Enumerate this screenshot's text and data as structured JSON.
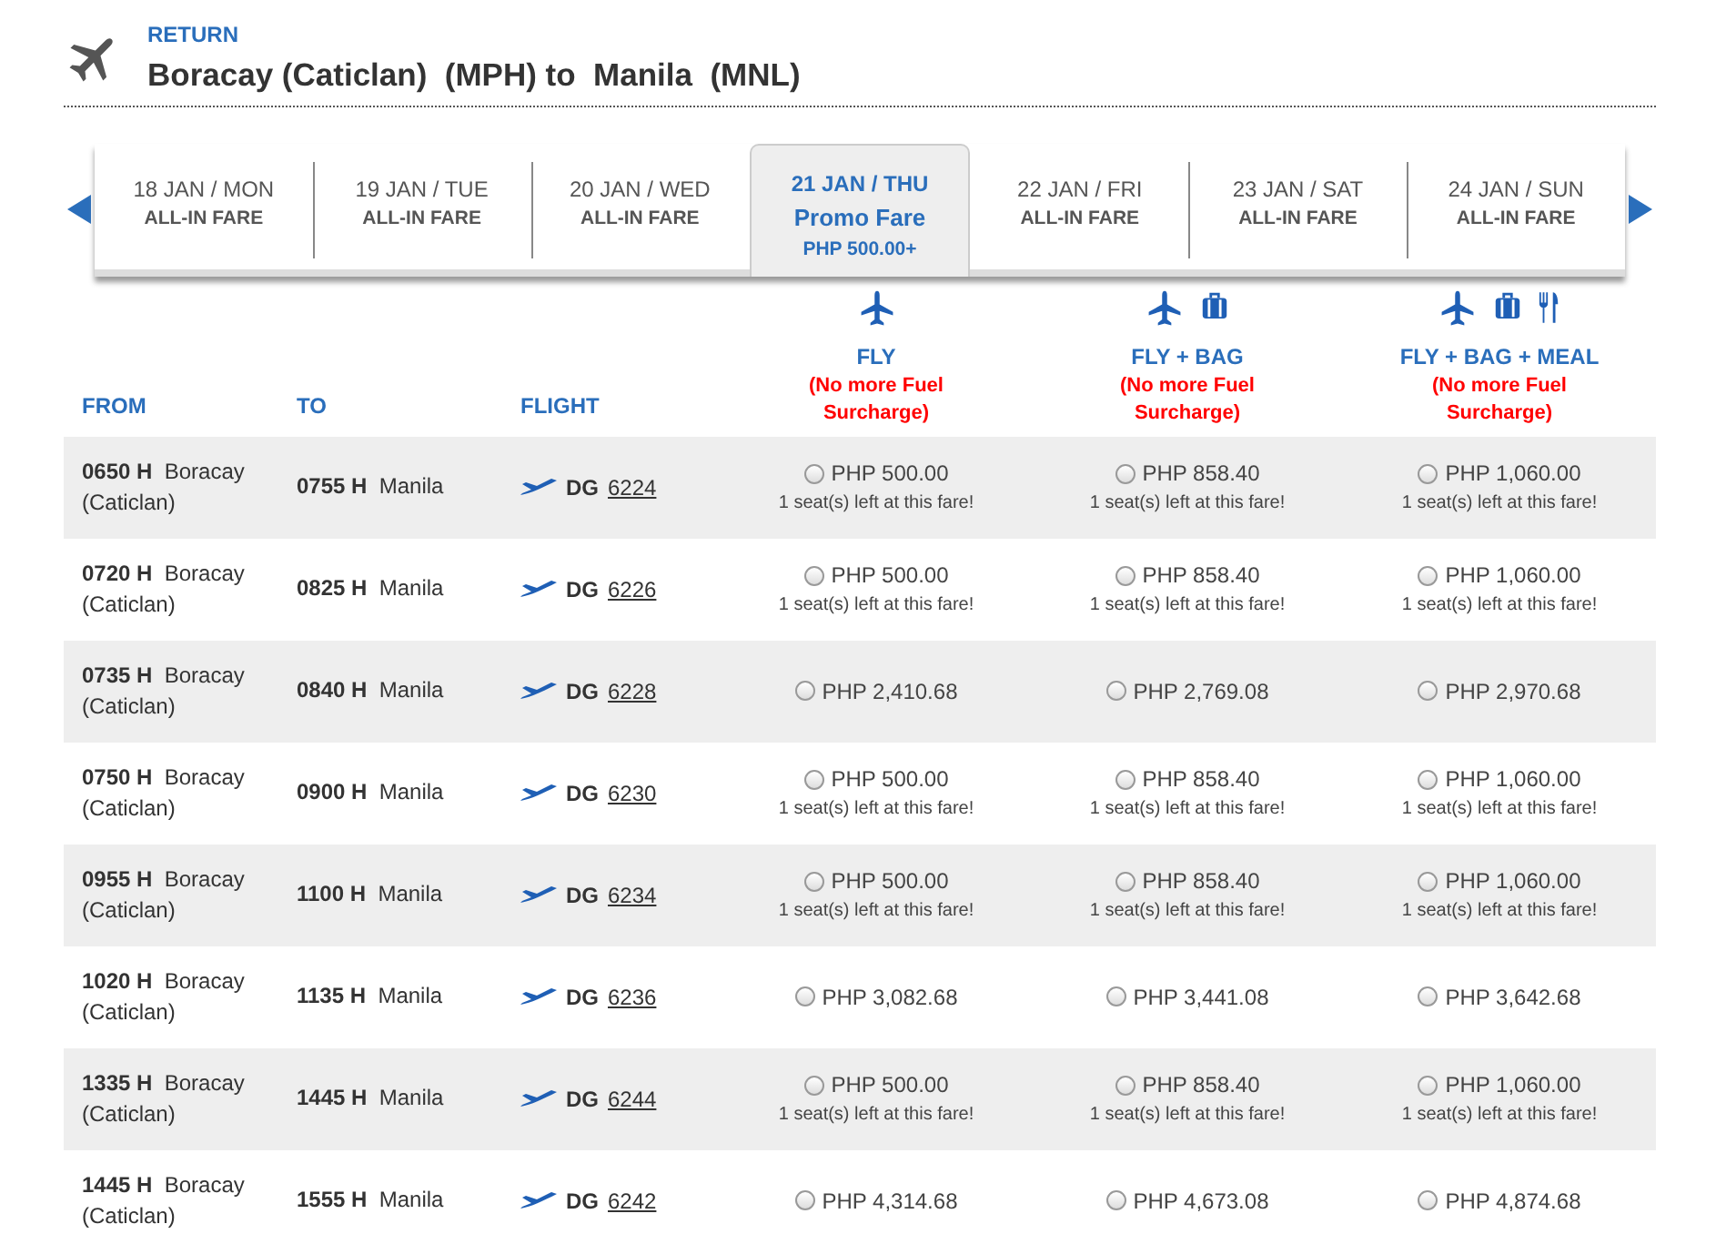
{
  "header": {
    "label": "RETURN",
    "route": "Boracay (Caticlan)  (MPH) to  Manila  (MNL)"
  },
  "dates": [
    {
      "date": "18 JAN / MON",
      "fare": "ALL-IN FARE",
      "selected": false
    },
    {
      "date": "19 JAN / TUE",
      "fare": "ALL-IN FARE",
      "selected": false
    },
    {
      "date": "20 JAN / WED",
      "fare": "ALL-IN FARE",
      "selected": false
    },
    {
      "date": "21 JAN / THU",
      "fare": "Promo Fare",
      "price": "PHP 500.00+",
      "selected": true
    },
    {
      "date": "22 JAN / FRI",
      "fare": "ALL-IN FARE",
      "selected": false
    },
    {
      "date": "23 JAN / SAT",
      "fare": "ALL-IN FARE",
      "selected": false
    },
    {
      "date": "24 JAN / SUN",
      "fare": "ALL-IN FARE",
      "selected": false
    }
  ],
  "columns": [
    "FROM",
    "TO",
    "FLIGHT"
  ],
  "fare_columns": [
    {
      "name": "FLY",
      "note": "(No more Fuel Surcharge)",
      "kind": "fly"
    },
    {
      "name": "FLY + BAG",
      "note": "(No more Fuel Surcharge)",
      "kind": "bag"
    },
    {
      "name": "FLY + BAG + MEAL",
      "note": "(No more Fuel Surcharge)",
      "kind": "meal"
    }
  ],
  "rows": [
    {
      "dep_time": "0650 H",
      "dep_city": "Boracay (Caticlan)",
      "arr_time": "0755 H",
      "arr_city": "Manila",
      "airline": "DG",
      "flight": "6224",
      "fares": [
        {
          "price": "PHP 500.00",
          "seats": "1 seat(s) left at this fare!",
          "selected": false
        },
        {
          "price": "PHP 858.40",
          "seats": "1 seat(s) left at this fare!",
          "selected": false
        },
        {
          "price": "PHP 1,060.00",
          "seats": "1 seat(s) left at this fare!",
          "selected": false
        }
      ]
    },
    {
      "dep_time": "0720 H",
      "dep_city": "Boracay (Caticlan)",
      "arr_time": "0825 H",
      "arr_city": "Manila",
      "airline": "DG",
      "flight": "6226",
      "fares": [
        {
          "price": "PHP 500.00",
          "seats": "1 seat(s) left at this fare!",
          "selected": false
        },
        {
          "price": "PHP 858.40",
          "seats": "1 seat(s) left at this fare!",
          "selected": false
        },
        {
          "price": "PHP 1,060.00",
          "seats": "1 seat(s) left at this fare!",
          "selected": false
        }
      ]
    },
    {
      "dep_time": "0735 H",
      "dep_city": "Boracay (Caticlan)",
      "arr_time": "0840 H",
      "arr_city": "Manila",
      "airline": "DG",
      "flight": "6228",
      "fares": [
        {
          "price": "PHP 2,410.68",
          "selected": false
        },
        {
          "price": "PHP 2,769.08",
          "selected": false
        },
        {
          "price": "PHP 2,970.68",
          "selected": false
        }
      ]
    },
    {
      "dep_time": "0750 H",
      "dep_city": "Boracay (Caticlan)",
      "arr_time": "0900 H",
      "arr_city": "Manila",
      "airline": "DG",
      "flight": "6230",
      "fares": [
        {
          "price": "PHP 500.00",
          "seats": "1 seat(s) left at this fare!",
          "selected": false
        },
        {
          "price": "PHP 858.40",
          "seats": "1 seat(s) left at this fare!",
          "selected": false
        },
        {
          "price": "PHP 1,060.00",
          "seats": "1 seat(s) left at this fare!",
          "selected": false
        }
      ]
    },
    {
      "dep_time": "0955 H",
      "dep_city": "Boracay (Caticlan)",
      "arr_time": "1100 H",
      "arr_city": "Manila",
      "airline": "DG",
      "flight": "6234",
      "fares": [
        {
          "price": "PHP 500.00",
          "seats": "1 seat(s) left at this fare!",
          "selected": false
        },
        {
          "price": "PHP 858.40",
          "seats": "1 seat(s) left at this fare!",
          "selected": false
        },
        {
          "price": "PHP 1,060.00",
          "seats": "1 seat(s) left at this fare!",
          "selected": false
        }
      ]
    },
    {
      "dep_time": "1020 H",
      "dep_city": "Boracay (Caticlan)",
      "arr_time": "1135 H",
      "arr_city": "Manila",
      "airline": "DG",
      "flight": "6236",
      "fares": [
        {
          "price": "PHP 3,082.68",
          "selected": false
        },
        {
          "price": "PHP 3,441.08",
          "selected": false
        },
        {
          "price": "PHP 3,642.68",
          "selected": false
        }
      ]
    },
    {
      "dep_time": "1335 H",
      "dep_city": "Boracay (Caticlan)",
      "arr_time": "1445 H",
      "arr_city": "Manila",
      "airline": "DG",
      "flight": "6244",
      "fares": [
        {
          "price": "PHP 500.00",
          "seats": "1 seat(s) left at this fare!",
          "selected": false
        },
        {
          "price": "PHP 858.40",
          "seats": "1 seat(s) left at this fare!",
          "selected": false
        },
        {
          "price": "PHP 1,060.00",
          "seats": "1 seat(s) left at this fare!",
          "selected": false
        }
      ]
    },
    {
      "dep_time": "1445 H",
      "dep_city": "Boracay (Caticlan)",
      "arr_time": "1555 H",
      "arr_city": "Manila",
      "airline": "DG",
      "flight": "6242",
      "fares": [
        {
          "price": "PHP 4,314.68",
          "selected": false
        },
        {
          "price": "PHP 4,673.08",
          "selected": false
        },
        {
          "price": "PHP 4,874.68",
          "selected": false
        }
      ]
    }
  ]
}
